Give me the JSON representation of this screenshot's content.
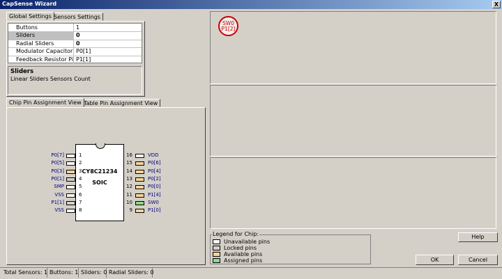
{
  "window": {
    "title": "CapSense Wizard",
    "close_glyph": "X"
  },
  "settings_tabs": [
    "Global Settings",
    "Sensors Settings"
  ],
  "global_settings": [
    {
      "label": "Buttons",
      "value": "1"
    },
    {
      "label": "Sliders",
      "value": "0"
    },
    {
      "label": "Radial Sliders",
      "value": "0"
    },
    {
      "label": "Modulator Capacitor",
      "value": "P0[1]"
    },
    {
      "label": "Feedback Resistor Pi",
      "value": "P1[1]"
    }
  ],
  "description": {
    "title": "Sliders",
    "text": "Linear Sliders Sensors Count"
  },
  "view_tabs": [
    "Chip Pin Assignment View",
    "Table Pin Assignment View"
  ],
  "chip": {
    "name": "CY8C21234",
    "package": "SOIC",
    "left_pins": [
      {
        "num": "1",
        "label": "P0[7]",
        "state": "unavailable"
      },
      {
        "num": "2",
        "label": "P0[5]",
        "state": "unavailable"
      },
      {
        "num": "3",
        "label": "P0[3]",
        "state": "available"
      },
      {
        "num": "4",
        "label": "P0[1]",
        "state": "locked"
      },
      {
        "num": "5",
        "label": "SMP",
        "state": "unavailable"
      },
      {
        "num": "6",
        "label": "VSS",
        "state": "unavailable"
      },
      {
        "num": "7",
        "label": "P1[1]",
        "state": "locked"
      },
      {
        "num": "8",
        "label": "VSS",
        "state": "unavailable"
      }
    ],
    "right_pins": [
      {
        "num": "16",
        "label": "VDD",
        "state": "unavailable"
      },
      {
        "num": "15",
        "label": "P0[6]",
        "state": "available"
      },
      {
        "num": "14",
        "label": "P0[4]",
        "state": "available"
      },
      {
        "num": "13",
        "label": "P0[2]",
        "state": "available"
      },
      {
        "num": "12",
        "label": "P0[0]",
        "state": "available"
      },
      {
        "num": "11",
        "label": "P1[4]",
        "state": "available"
      },
      {
        "num": "10",
        "label": "SW0",
        "state": "assigned"
      },
      {
        "num": "9",
        "label": "P1[0]",
        "state": "available"
      }
    ]
  },
  "pin_colors": {
    "unavailable": "#ffffff",
    "locked": "#d4d0c8",
    "available": "#f5d49b",
    "assigned": "#8cd98c"
  },
  "sensor_badge": {
    "name": "SW0",
    "pin": "P1[2]",
    "color": "#cc0000"
  },
  "legend": {
    "title": "Legend for Chip:",
    "items": [
      {
        "label": "Unavailable pins",
        "state": "unavailable"
      },
      {
        "label": "Locked pins",
        "state": "locked"
      },
      {
        "label": "Available pins",
        "state": "available"
      },
      {
        "label": "Assigned pins",
        "state": "assigned"
      }
    ]
  },
  "buttons": {
    "help": "Help",
    "ok": "OK",
    "cancel": "Cancel"
  },
  "status_bar": [
    "Total Sensors: 1",
    "Buttons: 1",
    "Sliders: 0",
    "Radial Sliders: 0"
  ]
}
